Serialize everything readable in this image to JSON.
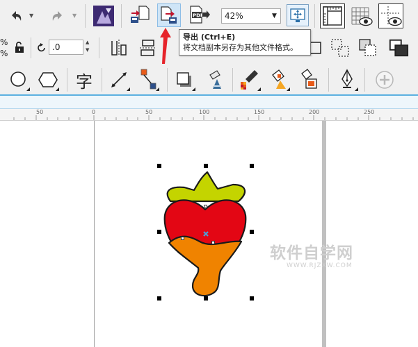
{
  "toolbar": {
    "zoom_value": "42%",
    "rotation_value": ".0",
    "partial_left_chars": [
      "%",
      "%"
    ]
  },
  "tooltip": {
    "title": "导出 (Ctrl+E)",
    "description": "将文档副本另存为其他文件格式。"
  },
  "ruler": {
    "labels": [
      "50",
      "0",
      "50",
      "100",
      "150",
      "200",
      "250"
    ]
  },
  "text_tool_glyph": "字",
  "pdf_label": "PDF",
  "watermark": {
    "title": "软件自学网",
    "url": "WWW.RJZXW.COM"
  },
  "colors": {
    "leaf": "#c4d400",
    "berry": "#e30614",
    "drip": "#f08300",
    "accent_arrow": "#e6232a",
    "tooltip_border": "#767676"
  }
}
